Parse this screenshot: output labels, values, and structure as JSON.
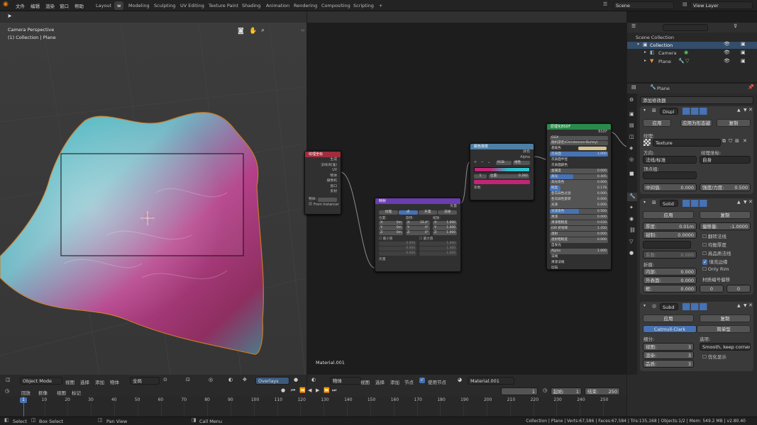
{
  "topbar": {
    "menus": [
      "文件",
      "编辑",
      "渲染",
      "窗口",
      "帮助"
    ],
    "workspaces": [
      "Layout",
      "w",
      "Modeling",
      "Sculpting",
      "UV Editing",
      "Texture Paint",
      "Shading",
      "Animation",
      "Rendering",
      "Compositing",
      "Scripting"
    ],
    "active_workspace": "w",
    "plus": "+",
    "scene": "Scene",
    "view_layer": "View Layer"
  },
  "viewport": {
    "overlay_line1": "Camera Perspective",
    "overlay_line2": "(1) Collection | Plane",
    "header": {
      "mode": "Object Mode",
      "view": "视图",
      "select": "选择",
      "add": "添加",
      "object": "物体",
      "orient": "全局",
      "overlays": "Overlays"
    }
  },
  "node_editor": {
    "header": {
      "object": "物体",
      "view": "视图",
      "select": "选择",
      "add": "添加",
      "node": "节点",
      "use_nodes": "使用节点",
      "material": "Material.001"
    },
    "material_label": "Material.001",
    "texcoord": {
      "title": "纹理坐标",
      "outputs": [
        "生成",
        "法线(标准)",
        "UV",
        "物体",
        "摄像机",
        "窗口",
        "反射"
      ],
      "object_label": "物体:",
      "from_instancer": "From Instancer"
    },
    "mapping": {
      "title": "映射",
      "type_label": "矢量",
      "types": [
        "纹理",
        "点",
        "矢量",
        "法线"
      ],
      "active_type": "点",
      "location": "位置:",
      "rotation": "旋转:",
      "scale": "缩放:",
      "loc": [
        [
          "X:",
          "0m"
        ],
        [
          "Y:",
          "0m"
        ],
        [
          "Z:",
          "0m"
        ]
      ],
      "rot": [
        [
          "X:",
          "33.4°"
        ],
        [
          "Y:",
          "0°"
        ],
        [
          "Z:",
          "0°"
        ]
      ],
      "scl": [
        [
          "X:",
          "1.000"
        ],
        [
          "Y:",
          "1.000"
        ],
        [
          "Z:",
          "1.000"
        ]
      ],
      "min_label": "最小值",
      "max_label": "最大值",
      "min": [
        "0.000",
        "0.000",
        "0.000"
      ],
      "max": [
        "1.000",
        "1.000",
        "1.000"
      ],
      "input": "矢量"
    },
    "ramp": {
      "title": "颜色渐变",
      "out_color": "颜色",
      "out_alpha": "Alpha",
      "mode": "RGB",
      "interp": "线性",
      "index": "1",
      "pos_label": "位置:",
      "pos": "0.282",
      "input": "系数"
    },
    "bsdf": {
      "title": "原理化BSDF",
      "output": "BSDF",
      "dist": "GGX",
      "sss_method": "随机游走(Christensen-Burley)",
      "rows": [
        [
          "基础色",
          ""
        ],
        [
          "次表面",
          "1.000"
        ],
        [
          "次表面半径",
          ""
        ],
        [
          "次表面颜色",
          ""
        ],
        [
          "金属度",
          "0.000"
        ],
        [
          "高光",
          "0.405"
        ],
        [
          "高光染色",
          "0.000"
        ],
        [
          "糙度",
          "0.178"
        ],
        [
          "各向异性过滤",
          "0.000"
        ],
        [
          "各向异性旋转",
          "0.000"
        ],
        [
          "光泽",
          "0.000"
        ],
        [
          "光泽染色",
          "0.500"
        ],
        [
          "清漆",
          "0.000"
        ],
        [
          "清漆粗糙度",
          "0.030"
        ],
        [
          "IOR 折射率",
          "1.450"
        ],
        [
          "透射",
          "0.000"
        ],
        [
          "透射粗糙度",
          "0.000"
        ],
        [
          "自发光",
          ""
        ],
        [
          "Alpha",
          "1.000"
        ],
        [
          "法线",
          ""
        ],
        [
          "清漆法线",
          ""
        ],
        [
          "切向",
          ""
        ]
      ]
    }
  },
  "outliner": {
    "scene_collection": "Scene Collection",
    "collection": "Collection",
    "camera": "Camera",
    "plane": "Plane"
  },
  "properties": {
    "object": "Plane",
    "add_modifier": "添加修改器",
    "disp": {
      "name": "Displ",
      "apply": "应用",
      "apply_as_shape": "应用为形态键",
      "copy": "复制",
      "texture_label": "纹理:",
      "texture": "Texture",
      "direction_label": "方向:",
      "direction": "法线/标准",
      "coords_label": "纹理坐标:",
      "coords": "自身",
      "vgroup_label": "顶点组:",
      "mid_label": "中间值:",
      "mid": "0.000",
      "strength_label": "强度/力度:",
      "strength": "0.500"
    },
    "solid": {
      "name": "Solid",
      "apply": "应用",
      "copy": "复制",
      "thick_label": "厚度:",
      "thick": "0.01m",
      "offset_label": "偏移量:",
      "offset": "-1.0000",
      "clamp_label": "钳制:",
      "clamp": "0.0000",
      "flip": "翻转法线",
      "even": "均衡厚度",
      "hq": "高品质法线",
      "fill_rim": "填充边缘",
      "only_rim": "Only Rim",
      "factor_label": "系数:",
      "factor": "0.000",
      "crease_label": "折痕:",
      "inner_label": "内部:",
      "inner": "0.000",
      "outer_label": "外表面:",
      "outer": "0.000",
      "rim_label": "框:",
      "rim": "0.000",
      "mat_offset_label": "材质编号偏移",
      "mat0": "0",
      "mat1": "0"
    },
    "subd": {
      "name": "Subd",
      "apply": "应用",
      "copy": "复制",
      "algo1": "Catmull-Clark",
      "algo2": "简单型",
      "subdiv_label": "细分:",
      "opts_label": "选项:",
      "view_label": "视图:",
      "view": "3",
      "render_label": "渲染:",
      "render": "3",
      "quality_label": "品质:",
      "quality": "3",
      "uv_smooth": "Smooth, keep corners",
      "optimal": "优化显示"
    }
  },
  "timeline": {
    "playback": "回放",
    "keying": "抠像",
    "view": "视图",
    "marker": "标记",
    "frame": "1",
    "start_label": "起始:",
    "start": "1",
    "end_label": "结束:",
    "end": "250",
    "ticks": [
      "1",
      "10",
      "20",
      "30",
      "40",
      "50",
      "60",
      "70",
      "80",
      "90",
      "100",
      "110",
      "120",
      "130",
      "140",
      "150",
      "160",
      "170",
      "180",
      "190",
      "200",
      "210",
      "220",
      "230",
      "240",
      "250"
    ]
  },
  "status": {
    "select": "Select",
    "box_select": "Box Select",
    "pan_view": "Pan View",
    "call_menu": "Call Menu",
    "stats": "Collection | Plane | Verts:67,586 | Faces:67,584 | Tris:135,168 | Objects:1/2 | Mem: 549.2 MB | v2.80.40"
  }
}
